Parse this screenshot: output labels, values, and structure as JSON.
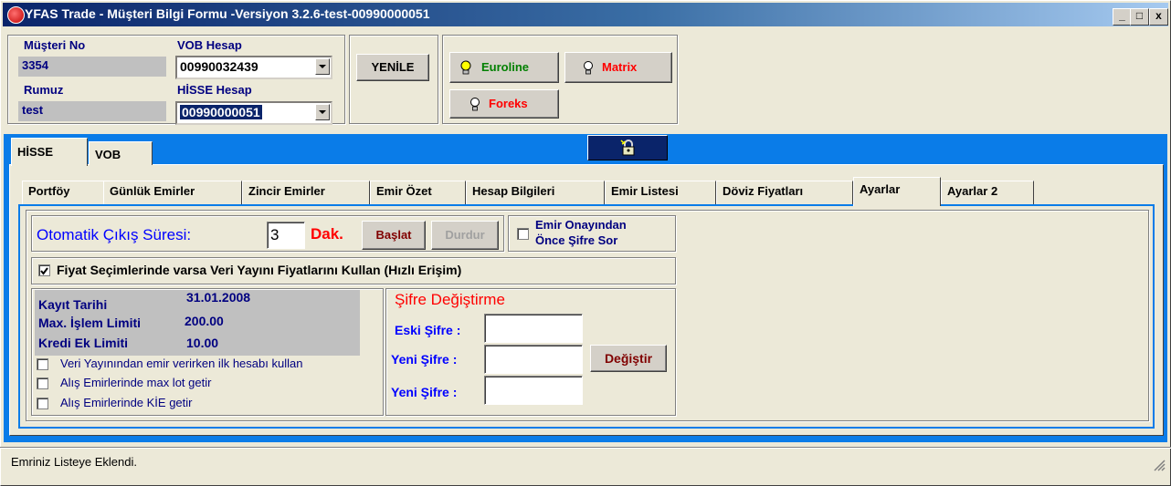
{
  "window": {
    "title": "YFAS Trade - Müşteri Bilgi Formu -Versiyon 3.2.6-test-00990000051",
    "controls": {
      "minimize": "_",
      "maximize": "□",
      "close": "x"
    }
  },
  "header": {
    "musteri_no_label": "Müşteri No",
    "musteri_no_value": "3354",
    "rumuz_label": "Rumuz",
    "rumuz_value": "test",
    "vob_hesap_label": "VOB Hesap",
    "vob_hesap_value": "00990032439",
    "hisse_hesap_label": "HİSSE Hesap",
    "hisse_hesap_value": "00990000051",
    "yenile_button": "YENİLE",
    "feeds": {
      "euroline": "Euroline",
      "matrix": "Matrix",
      "foreks": "Foreks"
    }
  },
  "outer_tabs": [
    "HİSSE",
    "VOB"
  ],
  "inner_tabs": [
    "Portföy",
    "Günlük Emirler",
    "Zincir Emirler",
    "Emir Özet",
    "Hesap Bilgileri",
    "Emir Listesi",
    "Döviz Fiyatları",
    "Ayarlar",
    "Ayarlar 2"
  ],
  "active_inner_tab": "Ayarlar",
  "settings": {
    "auto_logout_label": "Otomatik Çıkış Süresi:",
    "auto_logout_value": "3",
    "auto_logout_unit": "Dak.",
    "start_button": "Başlat",
    "stop_button": "Durdur",
    "confirm_password_line1": "Emir Onayından",
    "confirm_password_line2": "Önce Şifre Sor",
    "confirm_password_checked": false,
    "feed_prices_label": "Fiyat Seçimlerinde varsa Veri Yayını Fiyatlarını Kullan (Hızlı Erişim)",
    "feed_prices_checked": true
  },
  "account_info": {
    "kayit_tarihi_label": "Kayıt Tarihi",
    "kayit_tarihi_value": "31.01.2008",
    "max_islem_label": "Max. İşlem Limiti",
    "max_islem_value": "200.00",
    "kredi_ek_label": "Kredi Ek Limiti",
    "kredi_ek_value": "10.00"
  },
  "options": [
    {
      "label": "Veri Yayınından emir verirken ilk hesabı kullan",
      "checked": false
    },
    {
      "label": "Alış Emirlerinde max lot getir",
      "checked": false
    },
    {
      "label": "Alış Emirlerinde KİE getir",
      "checked": false
    }
  ],
  "password_change": {
    "title": "Şifre Değiştirme",
    "old_label": "Eski Şifre :",
    "new_label": "Yeni Şifre :",
    "confirm_label": "Yeni Şifre :",
    "change_button": "Değiştir"
  },
  "status": {
    "message": "Emriniz Listeye Eklendi."
  },
  "colors": {
    "title_start": "#0a246a",
    "panel_blue": "#0a7ce8",
    "label_navy": "#000080",
    "accent_red": "#ff0000",
    "dark_red": "#800000",
    "green": "#008000"
  }
}
